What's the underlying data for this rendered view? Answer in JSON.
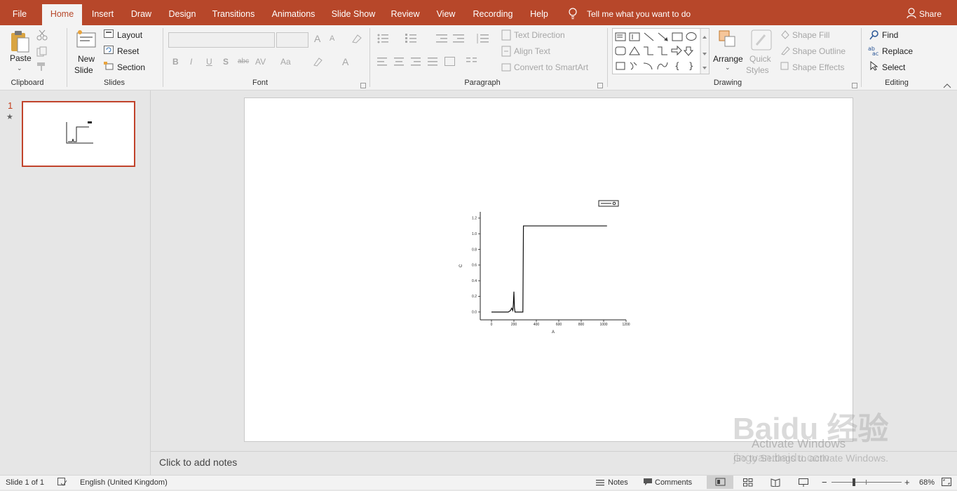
{
  "tabs": [
    "File",
    "Home",
    "Insert",
    "Draw",
    "Design",
    "Transitions",
    "Animations",
    "Slide Show",
    "Review",
    "View",
    "Recording",
    "Help"
  ],
  "active_tab": "Home",
  "tell_me": "Tell me what you want to do",
  "share": "Share",
  "clipboard": {
    "paste": "Paste",
    "group": "Clipboard"
  },
  "slides": {
    "new_slide_line1": "New",
    "new_slide_line2": "Slide",
    "layout": "Layout",
    "reset": "Reset",
    "section": "Section",
    "group": "Slides"
  },
  "font": {
    "group": "Font",
    "bold": "B",
    "italic": "I",
    "underline": "U",
    "shadow": "S",
    "strike": "abc",
    "spacing": "AV",
    "case": "Aa",
    "grow": "A",
    "shrink": "A",
    "color": "A"
  },
  "paragraph": {
    "group": "Paragraph",
    "text_direction": "Text Direction",
    "align_text": "Align Text",
    "convert_smartart": "Convert to SmartArt"
  },
  "drawing": {
    "group": "Drawing",
    "arrange": "Arrange",
    "quick_styles_1": "Quick",
    "quick_styles_2": "Styles",
    "shape_fill": "Shape Fill",
    "shape_outline": "Shape Outline",
    "shape_effects": "Shape Effects"
  },
  "editing": {
    "group": "Editing",
    "find": "Find",
    "replace": "Replace",
    "select": "Select"
  },
  "thumbnail": {
    "number": "1",
    "star": "★"
  },
  "chart_data": {
    "type": "line",
    "xlabel": "A",
    "ylabel": "C",
    "xticks": [
      "0",
      "200",
      "400",
      "600",
      "800",
      "1000",
      "1200"
    ],
    "yticks": [
      "0.0",
      "0.2",
      "0.4",
      "0.6",
      "0.8",
      "1.0",
      "1.2"
    ],
    "xlim": [
      -100,
      1200
    ],
    "ylim": [
      -0.1,
      1.28
    ],
    "series": [
      {
        "x": [
          0,
          150,
          170,
          180,
          190,
          195,
          200,
          205,
          210,
          220,
          280,
          285,
          290,
          1030
        ],
        "y": [
          0.0,
          0.0,
          0.02,
          0.05,
          0.02,
          0.1,
          0.26,
          0.05,
          0.0,
          0.0,
          0.0,
          1.1,
          1.1,
          1.1
        ]
      }
    ]
  },
  "notes_placeholder": "Click to add notes",
  "status": {
    "slide": "Slide 1 of 1",
    "language": "English (United Kingdom)",
    "notes": "Notes",
    "comments": "Comments",
    "zoom": "68%"
  },
  "watermark": {
    "line1": "Activate Windows",
    "line2": "Go to Settings to activate Windows.",
    "brand": "Baidu 经验",
    "url": "jingyan.baidu.com"
  }
}
